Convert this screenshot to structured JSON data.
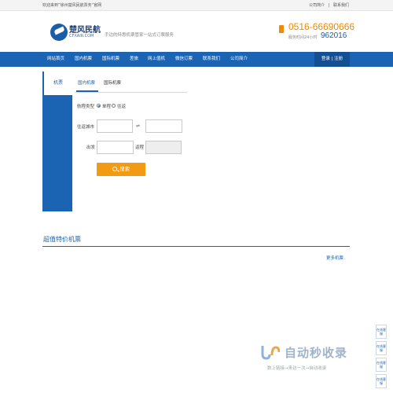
{
  "topbar": {
    "welcome": "欢迎来到”徐州楚风民航票务“官网",
    "links": [
      "公司简介",
      "|",
      "联系我们"
    ]
  },
  "header": {
    "logo_name": "楚风民航",
    "logo_domain": "CFXAIR.COM",
    "slogan": "手边的特惠机票管家一站式订票服务",
    "phone": "0516-66690666",
    "hours_label": "服务时间24小时",
    "hours_value": "962016"
  },
  "nav": {
    "items": [
      "网站首页",
      "国内机票",
      "国际机票",
      "差旅",
      "网上值机",
      "微信订票",
      "联系我们",
      "公司简介"
    ],
    "login": "登录 | 注册"
  },
  "sidebar": {
    "tab": "机票"
  },
  "search": {
    "tabs": [
      "国内机票",
      "国际机票"
    ],
    "route_type_label": "航程类型",
    "route_oneway": "单程",
    "route_round": "往返",
    "city_label": "往返城市",
    "depart_label": "出发",
    "return_label": "返程",
    "search_button": "搜索"
  },
  "specials": {
    "title": "超值特价机票",
    "more": "更多机票"
  },
  "float_panel": [
    "在线客服",
    "在线客服",
    "在线客服",
    "在线客服"
  ],
  "watermark": {
    "brand": "自动秒收录",
    "sub": "数上链接→来访一次→自动收录"
  },
  "colors": {
    "brand_blue": "#1b64b4",
    "accent_orange": "#f39a13"
  }
}
